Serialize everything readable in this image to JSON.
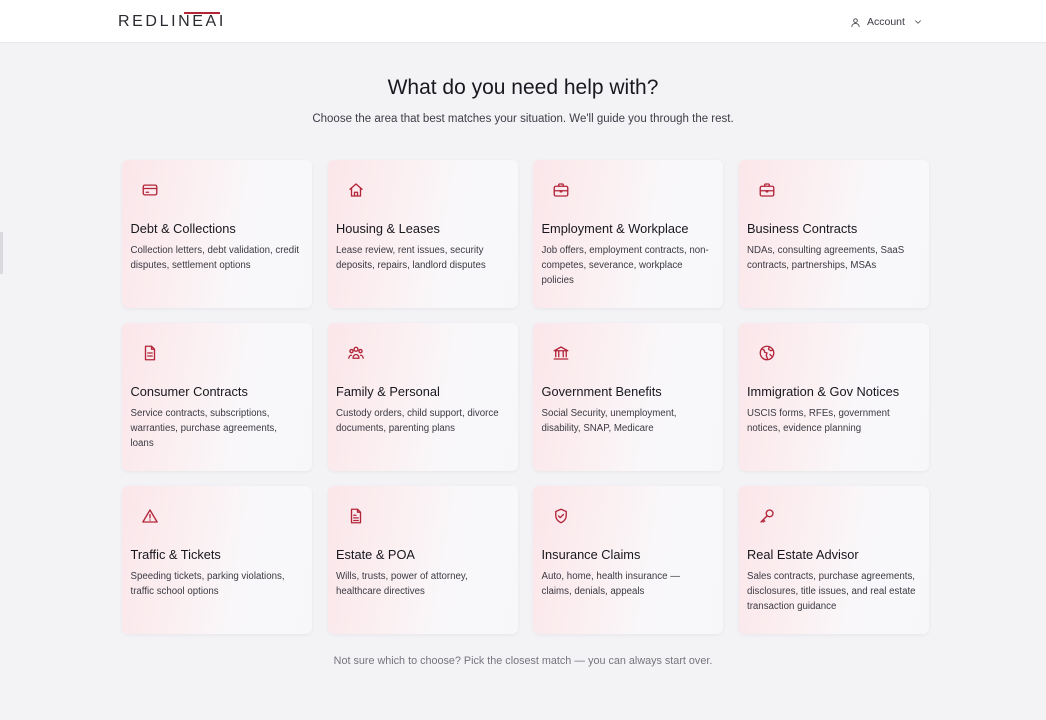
{
  "brand": {
    "logo_text": "REDLINEAI",
    "accent": "#b3263a"
  },
  "header": {
    "account_label": "Account",
    "user_icon": "user-icon",
    "chevron_icon": "chevron-down-icon"
  },
  "main": {
    "title": "What do you need help with?",
    "subtitle": "Choose the area that best matches your situation. We'll guide you through the rest.",
    "footnote": "Not sure which to choose? Pick the closest match — you can always start over."
  },
  "categories": [
    {
      "title": "Debt & Collections",
      "description": "Collection letters, debt validation, credit disputes, settlement options",
      "icon": "credit-card-icon"
    },
    {
      "title": "Housing & Leases",
      "description": "Lease review, rent issues, security deposits, repairs, landlord disputes",
      "icon": "home-icon"
    },
    {
      "title": "Employment & Workplace",
      "description": "Job offers, employment contracts, non-competes, severance, workplace policies",
      "icon": "briefcase-icon"
    },
    {
      "title": "Business Contracts",
      "description": "NDAs, consulting agreements, SaaS contracts, partnerships, MSAs",
      "icon": "briefcase-icon"
    },
    {
      "title": "Consumer Contracts",
      "description": "Service contracts, subscriptions, warranties, purchase agreements, loans",
      "icon": "document-icon"
    },
    {
      "title": "Family & Personal",
      "description": "Custody orders, child support, divorce documents, parenting plans",
      "icon": "people-icon"
    },
    {
      "title": "Government Benefits",
      "description": "Social Security, unemployment, disability, SNAP, Medicare",
      "icon": "bank-icon"
    },
    {
      "title": "Immigration & Gov Notices",
      "description": "USCIS forms, RFEs, government notices, evidence planning",
      "icon": "globe-icon"
    },
    {
      "title": "Traffic & Tickets",
      "description": "Speeding tickets, parking violations, traffic school options",
      "icon": "warning-icon"
    },
    {
      "title": "Estate & POA",
      "description": "Wills, trusts, power of attorney, healthcare directives",
      "icon": "file-text-icon"
    },
    {
      "title": "Insurance Claims",
      "description": "Auto, home, health insurance — claims, denials, appeals",
      "icon": "shield-check-icon"
    },
    {
      "title": "Real Estate Advisor",
      "description": "Sales contracts, purchase agreements, disclosures, title issues, and real estate transaction guidance",
      "icon": "key-icon"
    }
  ]
}
